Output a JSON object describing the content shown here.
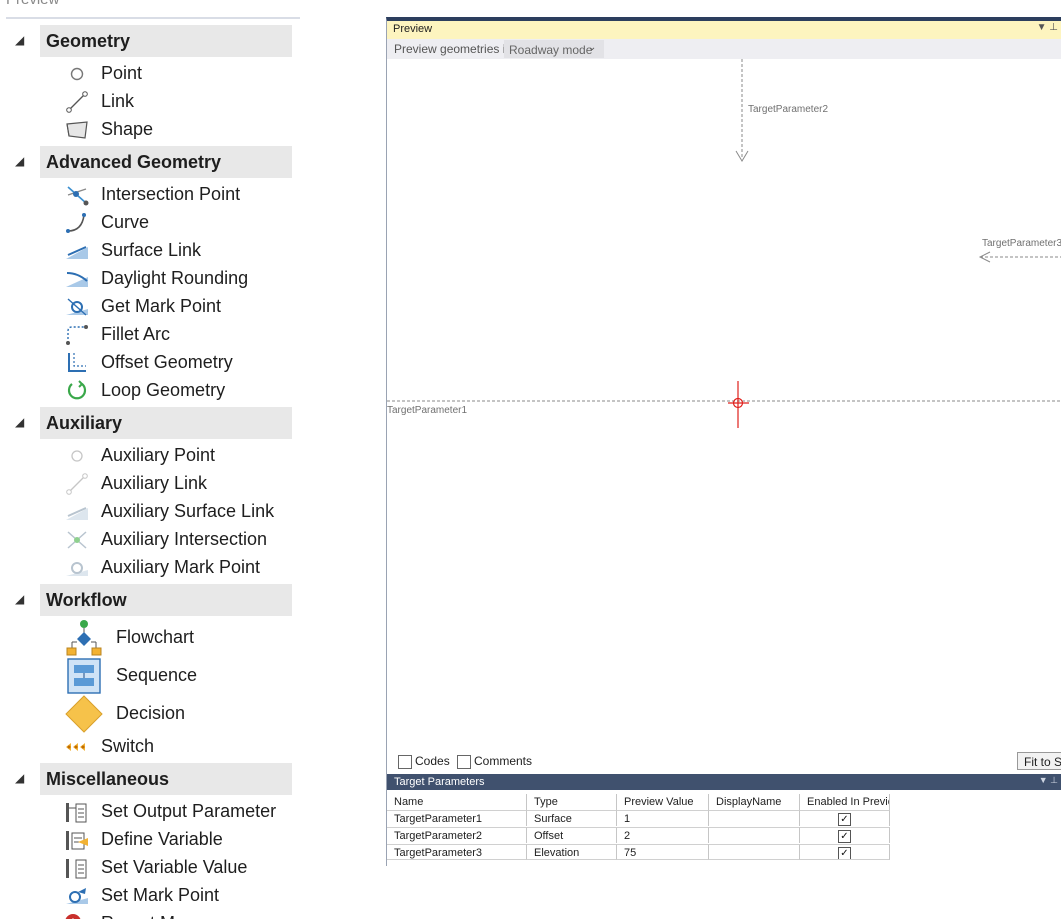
{
  "toolbox": {
    "partial_title": "Preview",
    "categories": [
      {
        "label": "Geometry",
        "items": [
          {
            "label": "Point",
            "icon": "point-icon"
          },
          {
            "label": "Link",
            "icon": "link-icon"
          },
          {
            "label": "Shape",
            "icon": "shape-icon"
          }
        ]
      },
      {
        "label": "Advanced Geometry",
        "items": [
          {
            "label": "Intersection Point",
            "icon": "intersection-point-icon"
          },
          {
            "label": "Curve",
            "icon": "curve-icon"
          },
          {
            "label": "Surface Link",
            "icon": "surface-link-icon"
          },
          {
            "label": "Daylight Rounding",
            "icon": "daylight-rounding-icon"
          },
          {
            "label": "Get Mark Point",
            "icon": "get-mark-point-icon"
          },
          {
            "label": "Fillet Arc",
            "icon": "fillet-arc-icon"
          },
          {
            "label": "Offset Geometry",
            "icon": "offset-geometry-icon"
          },
          {
            "label": "Loop Geometry",
            "icon": "loop-geometry-icon"
          }
        ]
      },
      {
        "label": "Auxiliary",
        "items": [
          {
            "label": "Auxiliary Point",
            "icon": "auxiliary-point-icon"
          },
          {
            "label": "Auxiliary Link",
            "icon": "auxiliary-link-icon"
          },
          {
            "label": "Auxiliary Surface Link",
            "icon": "auxiliary-surface-link-icon"
          },
          {
            "label": "Auxiliary Intersection",
            "icon": "auxiliary-intersection-icon"
          },
          {
            "label": "Auxiliary Mark Point",
            "icon": "auxiliary-mark-point-icon"
          }
        ]
      },
      {
        "label": "Workflow",
        "items": [
          {
            "label": "Flowchart",
            "icon": "flowchart-icon"
          },
          {
            "label": "Sequence",
            "icon": "sequence-icon"
          },
          {
            "label": "Decision",
            "icon": "decision-icon"
          },
          {
            "label": "Switch",
            "icon": "switch-icon"
          }
        ]
      },
      {
        "label": "Miscellaneous",
        "items": [
          {
            "label": "Set Output Parameter",
            "icon": "set-output-parameter-icon"
          },
          {
            "label": "Define Variable",
            "icon": "define-variable-icon"
          },
          {
            "label": "Set Variable Value",
            "icon": "set-variable-value-icon"
          },
          {
            "label": "Set Mark Point",
            "icon": "set-mark-point-icon"
          },
          {
            "label": "Report Message",
            "icon": "report-message-icon"
          }
        ]
      }
    ]
  },
  "preview": {
    "title": "Preview",
    "mode_label": "Preview geometries in",
    "mode_value": "Roadway mode",
    "canvas_labels": {
      "p1": "TargetParameter1",
      "p2": "TargetParameter2",
      "p3": "TargetParameter3"
    },
    "codes_label": "Codes",
    "comments_label": "Comments",
    "fit_button": "Fit to Sc",
    "colors": {
      "origin": "#e0201c",
      "guide": "#8a8a8a",
      "header": "#fdf4bf"
    }
  },
  "target_parameters": {
    "title": "Target Parameters",
    "columns": [
      "Name",
      "Type",
      "Preview Value",
      "DisplayName",
      "Enabled In Previe"
    ],
    "rows": [
      {
        "name": "TargetParameter1",
        "type": "Surface",
        "value": "1",
        "display": "",
        "enabled": true
      },
      {
        "name": "TargetParameter2",
        "type": "Offset",
        "value": "2",
        "display": "",
        "enabled": true
      },
      {
        "name": "TargetParameter3",
        "type": "Elevation",
        "value": "75",
        "display": "",
        "enabled": true
      }
    ]
  }
}
